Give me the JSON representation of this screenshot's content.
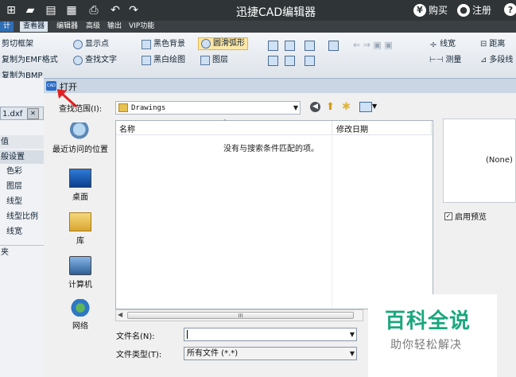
{
  "app": {
    "title": "迅捷CAD编辑器"
  },
  "title_bar_right": {
    "buy": "购买",
    "register": "注册",
    "help": "?"
  },
  "menu_tabs": [
    "计",
    "查看器",
    "编辑器",
    "高级",
    "输出",
    "VIP功能"
  ],
  "ribbon": {
    "col1": [
      "剪切框架",
      "复制为EMF格式",
      "复制为BMP"
    ],
    "col2": [
      "显示点",
      "查找文字"
    ],
    "col3": [
      "黑色背景",
      "黑白绘图"
    ],
    "col4": [
      "圆滑弧形",
      "图层"
    ],
    "col5": [
      "线宽",
      "测量"
    ],
    "col6": [
      "距离",
      "多段线"
    ]
  },
  "left_panel": {
    "file_tab": "1.dxf",
    "rows": [
      "值",
      "般设置",
      "色彩",
      "图层",
      "线型",
      "线型比例",
      "线宽",
      "夹"
    ]
  },
  "dialog": {
    "title": "打开",
    "icon_text": "CAD",
    "lookin_label": "查找范围(I):",
    "lookin_value": "Drawings",
    "places": [
      "最近访问的位置",
      "桌面",
      "库",
      "计算机",
      "网络"
    ],
    "columns": {
      "name": "名称",
      "modified": "修改日期"
    },
    "empty_message": "没有与搜索条件匹配的项。",
    "filename_label": "文件名(N):",
    "filename_value": "",
    "filetype_label": "文件类型(T):",
    "filetype_value": "所有文件 (*.*)",
    "preview_text": "(None)",
    "enable_preview_label": "启用预览",
    "scroll_thumb": "III"
  },
  "watermark": {
    "title": "百科全说",
    "subtitle": "助你轻松解决"
  },
  "colors": {
    "titlebar": "#2f3437",
    "watermark_green": "#1aa77e",
    "arrow_red": "#e02020"
  }
}
